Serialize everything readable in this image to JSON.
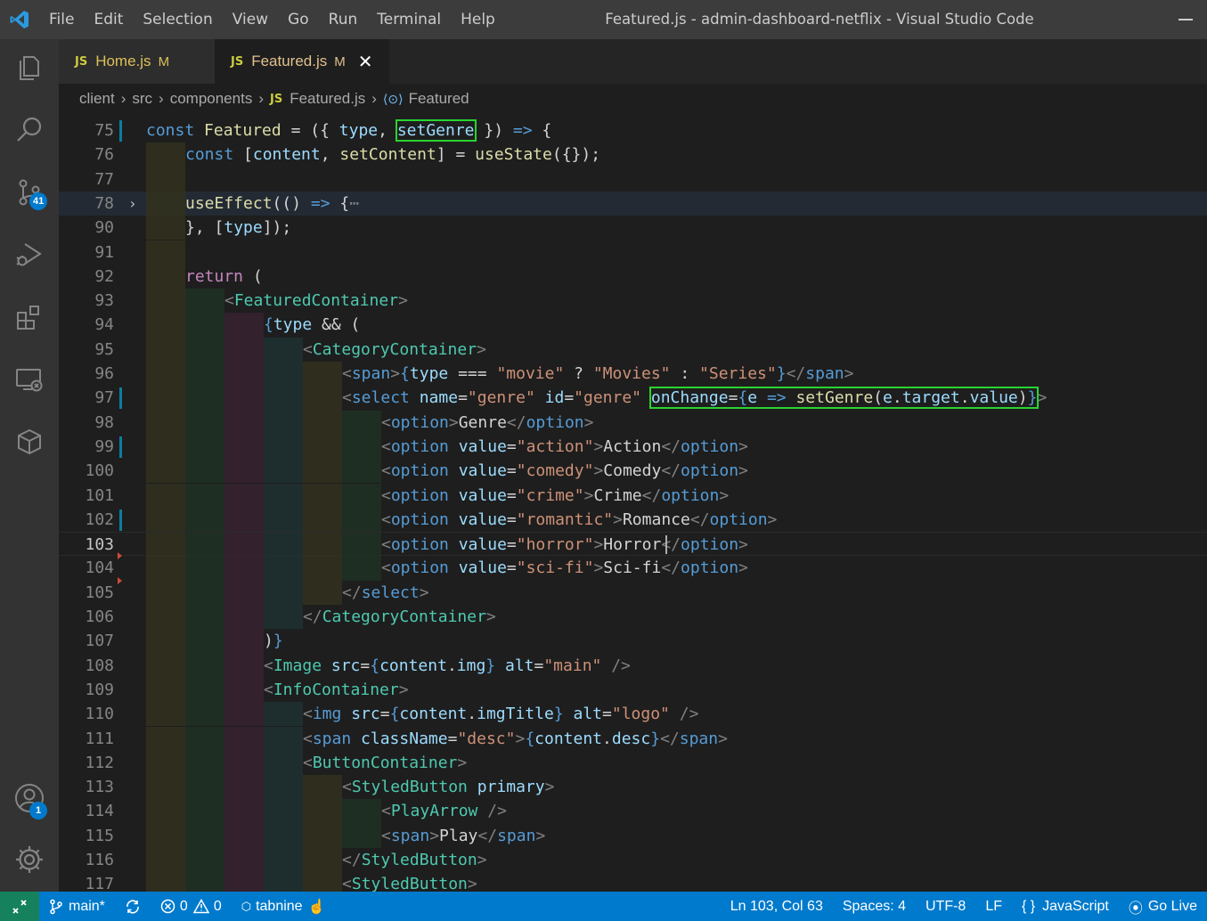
{
  "window": {
    "title": "Featured.js - admin-dashboard-netflix - Visual Studio Code"
  },
  "menu": [
    "File",
    "Edit",
    "Selection",
    "View",
    "Go",
    "Run",
    "Terminal",
    "Help"
  ],
  "activity": {
    "source_control_badge": "41",
    "accounts_badge": "1"
  },
  "tabs": [
    {
      "label": "Home.js",
      "icon": "JS",
      "status": "M"
    },
    {
      "label": "Featured.js",
      "icon": "JS",
      "status": "M",
      "close": "✕"
    }
  ],
  "breadcrumb": {
    "parts": [
      "client",
      "src",
      "components"
    ],
    "file": "Featured.js",
    "file_icon": "JS",
    "symbol": "Featured"
  },
  "editor": {
    "current_line": "103",
    "lines": [
      {
        "n": "75"
      },
      {
        "n": "76"
      },
      {
        "n": "77"
      },
      {
        "n": "78"
      },
      {
        "n": "90"
      },
      {
        "n": "91"
      },
      {
        "n": "92"
      },
      {
        "n": "93"
      },
      {
        "n": "94"
      },
      {
        "n": "95"
      },
      {
        "n": "96"
      },
      {
        "n": "97"
      },
      {
        "n": "98"
      },
      {
        "n": "99"
      },
      {
        "n": "100"
      },
      {
        "n": "101"
      },
      {
        "n": "102"
      },
      {
        "n": "103"
      },
      {
        "n": "104"
      },
      {
        "n": "105"
      },
      {
        "n": "106"
      },
      {
        "n": "107"
      },
      {
        "n": "108"
      },
      {
        "n": "109"
      },
      {
        "n": "110"
      },
      {
        "n": "111"
      },
      {
        "n": "112"
      },
      {
        "n": "113"
      },
      {
        "n": "114"
      },
      {
        "n": "115"
      },
      {
        "n": "116"
      },
      {
        "n": "117"
      }
    ],
    "folded_placeholder": "⋯"
  },
  "status": {
    "branch": "main*",
    "errors": "0",
    "warnings": "0",
    "tabnine": "tabnine",
    "cursor": "Ln 103, Col 63",
    "spaces": "Spaces: 4",
    "encoding": "UTF-8",
    "eol": "LF",
    "language": "JavaScript",
    "language_icon": "{ }",
    "golive": "Go Live"
  },
  "colors": {
    "status_bar": "#007acc",
    "highlight_box": "#29d431",
    "activity_badge": "#007acc"
  }
}
